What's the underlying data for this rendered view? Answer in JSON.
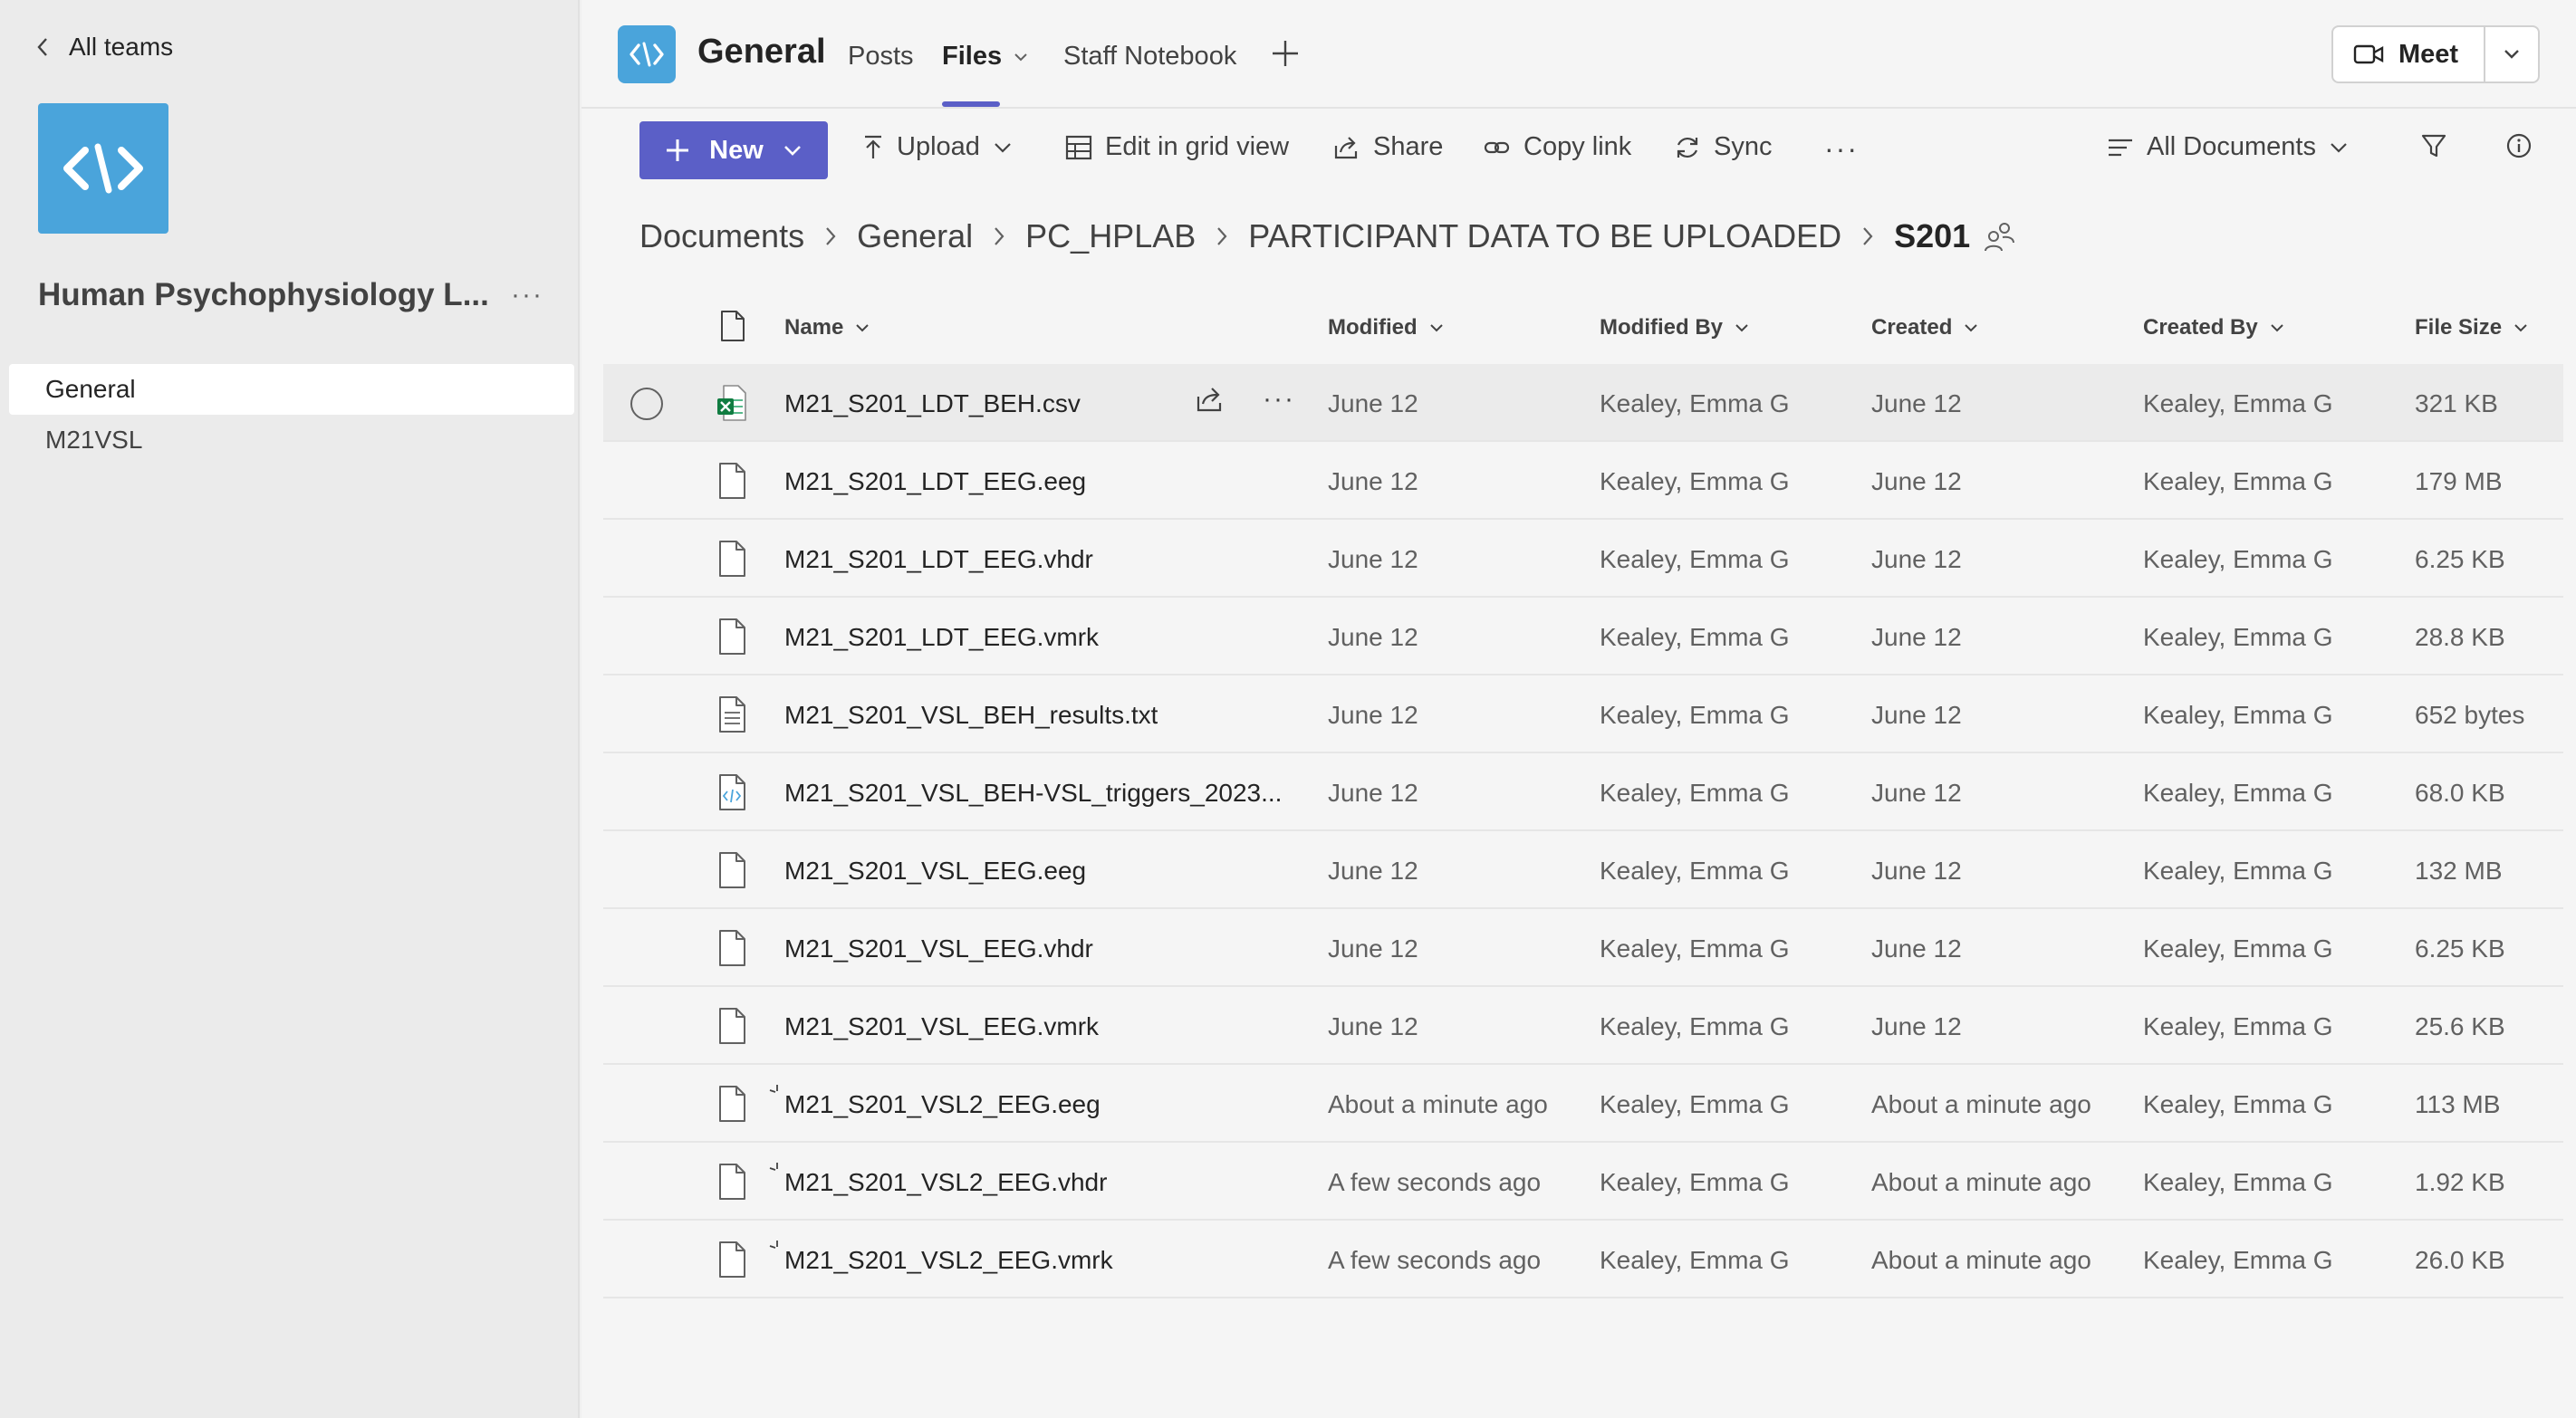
{
  "sidebar": {
    "back_label": "All teams",
    "team_name": "Human Psychophysiology L...",
    "channels": [
      {
        "label": "General",
        "active": true
      },
      {
        "label": "M21VSL",
        "active": false
      }
    ]
  },
  "header": {
    "channel_title": "General",
    "tabs": {
      "posts": "Posts",
      "files": "Files",
      "notebook": "Staff Notebook"
    },
    "meet_label": "Meet"
  },
  "toolbar": {
    "new_label": "New",
    "upload_label": "Upload",
    "grid_label": "Edit in grid view",
    "share_label": "Share",
    "copy_link_label": "Copy link",
    "sync_label": "Sync",
    "view_label": "All Documents"
  },
  "breadcrumb": [
    "Documents",
    "General",
    "PC_HPLAB",
    "PARTICIPANT DATA TO BE UPLOADED",
    "S201"
  ],
  "columns": {
    "name": "Name",
    "modified": "Modified",
    "modified_by": "Modified By",
    "created": "Created",
    "created_by": "Created By",
    "file_size": "File Size"
  },
  "files": [
    {
      "name": "M21_S201_LDT_BEH.csv",
      "icon": "excel-file-icon",
      "modified": "June 12",
      "modified_by": "Kealey, Emma G",
      "created": "June 12",
      "created_by": "Kealey, Emma G",
      "size": "321 KB"
    },
    {
      "name": "M21_S201_LDT_EEG.eeg",
      "icon": "generic-file-icon",
      "modified": "June 12",
      "modified_by": "Kealey, Emma G",
      "created": "June 12",
      "created_by": "Kealey, Emma G",
      "size": "179 MB"
    },
    {
      "name": "M21_S201_LDT_EEG.vhdr",
      "icon": "generic-file-icon",
      "modified": "June 12",
      "modified_by": "Kealey, Emma G",
      "created": "June 12",
      "created_by": "Kealey, Emma G",
      "size": "6.25 KB"
    },
    {
      "name": "M21_S201_LDT_EEG.vmrk",
      "icon": "generic-file-icon",
      "modified": "June 12",
      "modified_by": "Kealey, Emma G",
      "created": "June 12",
      "created_by": "Kealey, Emma G",
      "size": "28.8 KB"
    },
    {
      "name": "M21_S201_VSL_BEH_results.txt",
      "icon": "text-file-icon",
      "modified": "June 12",
      "modified_by": "Kealey, Emma G",
      "created": "June 12",
      "created_by": "Kealey, Emma G",
      "size": "652 bytes"
    },
    {
      "name": "M21_S201_VSL_BEH-VSL_triggers_2023...",
      "icon": "code-file-icon",
      "modified": "June 12",
      "modified_by": "Kealey, Emma G",
      "created": "June 12",
      "created_by": "Kealey, Emma G",
      "size": "68.0 KB"
    },
    {
      "name": "M21_S201_VSL_EEG.eeg",
      "icon": "generic-file-icon",
      "modified": "June 12",
      "modified_by": "Kealey, Emma G",
      "created": "June 12",
      "created_by": "Kealey, Emma G",
      "size": "132 MB"
    },
    {
      "name": "M21_S201_VSL_EEG.vhdr",
      "icon": "generic-file-icon",
      "modified": "June 12",
      "modified_by": "Kealey, Emma G",
      "created": "June 12",
      "created_by": "Kealey, Emma G",
      "size": "6.25 KB"
    },
    {
      "name": "M21_S201_VSL_EEG.vmrk",
      "icon": "generic-file-icon",
      "modified": "June 12",
      "modified_by": "Kealey, Emma G",
      "created": "June 12",
      "created_by": "Kealey, Emma G",
      "size": "25.6 KB"
    },
    {
      "name": "M21_S201_VSL2_EEG.eeg",
      "icon": "generic-file-icon",
      "new": true,
      "modified": "About a minute ago",
      "modified_by": "Kealey, Emma G",
      "created": "About a minute ago",
      "created_by": "Kealey, Emma G",
      "size": "113 MB"
    },
    {
      "name": "M21_S201_VSL2_EEG.vhdr",
      "icon": "generic-file-icon",
      "new": true,
      "modified": "A few seconds ago",
      "modified_by": "Kealey, Emma G",
      "created": "About a minute ago",
      "created_by": "Kealey, Emma G",
      "size": "1.92 KB"
    },
    {
      "name": "M21_S201_VSL2_EEG.vmrk",
      "icon": "generic-file-icon",
      "new": true,
      "modified": "A few seconds ago",
      "modified_by": "Kealey, Emma G",
      "created": "About a minute ago",
      "created_by": "Kealey, Emma G",
      "size": "26.0 KB"
    }
  ],
  "colors": {
    "accent": "#5b5fc7",
    "team_logo": "#4aa4db",
    "excel": "#107c41"
  }
}
